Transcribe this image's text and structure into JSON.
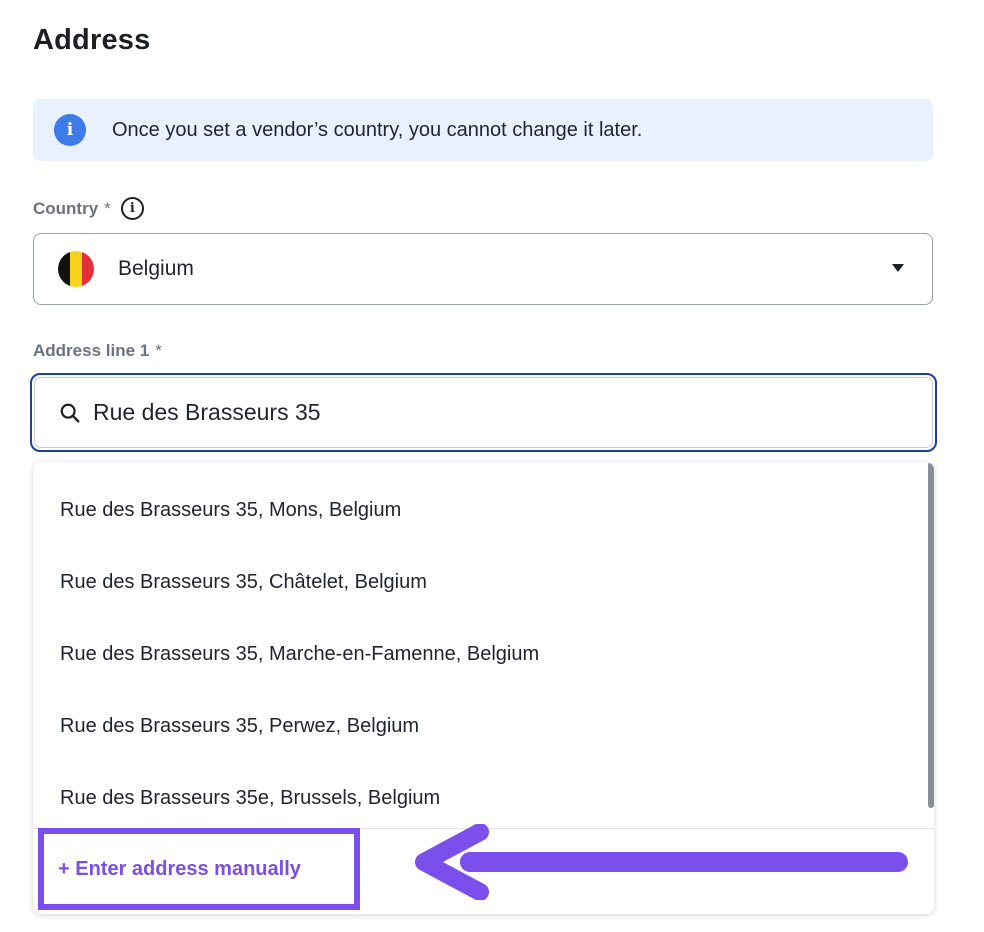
{
  "section": {
    "title": "Address"
  },
  "banner": {
    "icon": "info-icon",
    "text": "Once you set a vendor’s country, you cannot change it later."
  },
  "country": {
    "label": "Country",
    "required_mark": "*",
    "help_icon": "info-outline-icon",
    "selected_value": "Belgium",
    "flag_colors": [
      "#111111",
      "#f7d31c",
      "#e5303a"
    ]
  },
  "address_line_1": {
    "label": "Address line 1",
    "required_mark": "*",
    "value": "Rue des Brasseurs 35",
    "icon": "search-icon"
  },
  "suggestions": [
    "Rue des Brasseurs 35, Mons, Belgium",
    "Rue des Brasseurs 35, Châtelet, Belgium",
    "Rue des Brasseurs 35, Marche-en-Famenne, Belgium",
    "Rue des Brasseurs 35, Perwez, Belgium",
    "Rue des Brasseurs 35e, Brussels, Belgium"
  ],
  "manual_entry": {
    "label": "+ Enter address manually"
  },
  "annotation": {
    "color": "#7a4fec",
    "type": "arrow-and-highlight-box"
  }
}
